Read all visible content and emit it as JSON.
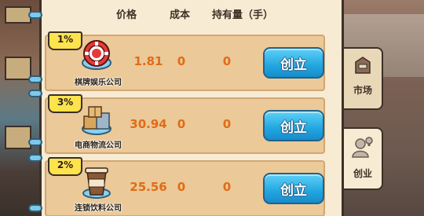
{
  "header": {
    "price": "价格",
    "cost": "成本",
    "holding": "持有量（手）"
  },
  "rows": [
    {
      "percent": "1%",
      "name": "棋牌娱乐公司",
      "price": "1.81",
      "cost": "0",
      "holding": "0",
      "button": "创立",
      "icon": "poker-chip-icon"
    },
    {
      "percent": "3%",
      "name": "电商物流公司",
      "price": "30.94",
      "cost": "0",
      "holding": "0",
      "button": "创立",
      "icon": "cardboard-boxes-icon"
    },
    {
      "percent": "2%",
      "name": "连锁饮料公司",
      "price": "25.56",
      "cost": "0",
      "holding": "0",
      "button": "创立",
      "icon": "coffee-cup-icon"
    }
  ],
  "tabs": {
    "market": "市场",
    "startup": "创业"
  },
  "colors": {
    "price_text": "#e06c18",
    "button": "#22a6e0",
    "badge": "#ffe34d",
    "row_bg": "#ebc998",
    "panel_bg": "#f7ebd3"
  }
}
